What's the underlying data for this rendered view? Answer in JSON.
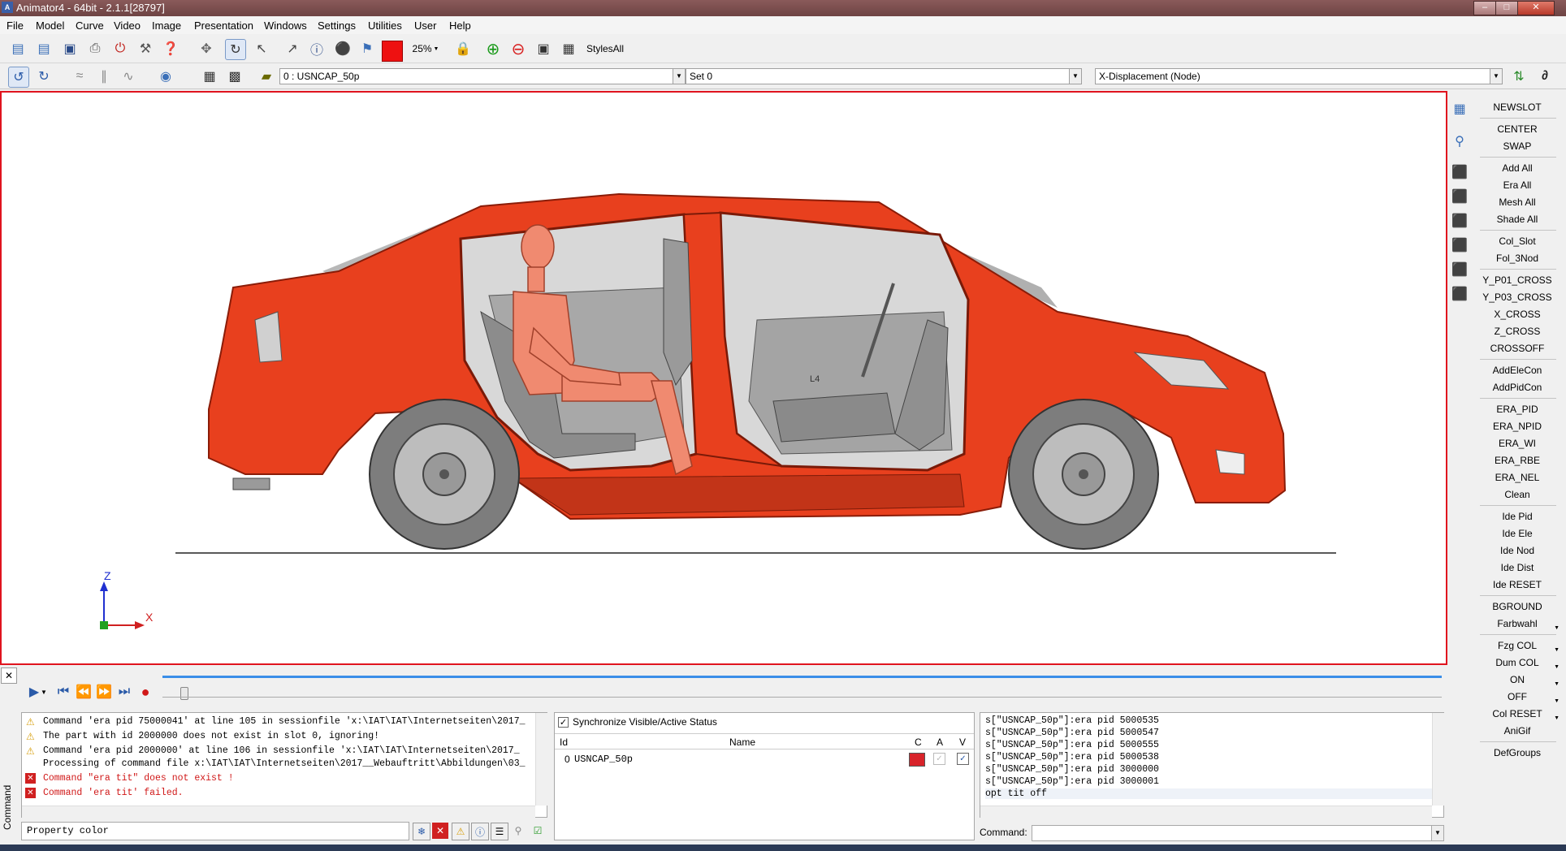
{
  "window": {
    "title": "Animator4 - 64bit - 2.1.1[28797]",
    "app_icon_text": "A"
  },
  "menu": [
    "File",
    "Model",
    "Curve",
    "Video",
    "Image",
    "Presentation",
    "Windows",
    "Settings",
    "Utilities",
    "User",
    "Help"
  ],
  "toolbar1": {
    "zoom_label": "25%",
    "styles_label": "StylesAll"
  },
  "toolbar2": {
    "model_combo": "0 : USNCAP_50p",
    "set_combo": "Set 0",
    "result_combo": "X-Displacement (Node)"
  },
  "viewport": {
    "axis_z": "Z",
    "axis_x": "X",
    "dummy_label": "L4"
  },
  "right_panel": [
    {
      "label": "NEWSLOT"
    },
    {
      "label": "CENTER"
    },
    {
      "label": "SWAP"
    },
    {
      "label": "Add All"
    },
    {
      "label": "Era All"
    },
    {
      "label": "Mesh All"
    },
    {
      "label": "Shade All"
    },
    {
      "label": "Col_Slot"
    },
    {
      "label": "Fol_3Nod"
    },
    {
      "label": "Y_P01_CROSS"
    },
    {
      "label": "Y_P03_CROSS"
    },
    {
      "label": "X_CROSS"
    },
    {
      "label": "Z_CROSS"
    },
    {
      "label": "CROSSOFF"
    },
    {
      "label": "AddEleCon"
    },
    {
      "label": "AddPidCon"
    },
    {
      "label": "ERA_PID"
    },
    {
      "label": "ERA_NPID"
    },
    {
      "label": "ERA_WI"
    },
    {
      "label": "ERA_RBE"
    },
    {
      "label": "ERA_NEL"
    },
    {
      "label": "Clean"
    },
    {
      "label": "Ide Pid"
    },
    {
      "label": "Ide Ele"
    },
    {
      "label": "Ide Nod"
    },
    {
      "label": "Ide Dist"
    },
    {
      "label": "Ide RESET"
    },
    {
      "label": "BGROUND"
    },
    {
      "label": "Farbwahl"
    },
    {
      "label": "Fzg COL"
    },
    {
      "label": "Dum COL"
    },
    {
      "label": "ON"
    },
    {
      "label": "OFF"
    },
    {
      "label": "Col RESET"
    },
    {
      "label": "AniGif"
    },
    {
      "label": "DefGroups"
    }
  ],
  "log": {
    "vertical_tab": "Command",
    "lines": [
      {
        "type": "warn",
        "text": "Command 'era pid 75000041' at line 105 in sessionfile 'x:\\IAT\\IAT\\Internetseiten\\2017_"
      },
      {
        "type": "warn",
        "text": "The part with id 2000000 does not exist in slot 0, ignoring!"
      },
      {
        "type": "warn",
        "text": "Command 'era pid 2000000' at line 106 in sessionfile 'x:\\IAT\\IAT\\Internetseiten\\2017_"
      },
      {
        "type": "info",
        "text": "Processing of command file x:\\IAT\\IAT\\Internetseiten\\2017__Webauftritt\\Abbildungen\\03_"
      },
      {
        "type": "error",
        "text": "Command \"era tit\" does not exist !"
      },
      {
        "type": "error",
        "text": "Command 'era tit' failed."
      }
    ],
    "property_label": "Property color"
  },
  "properties": {
    "sync_label": "Synchronize Visible/Active Status",
    "col_id": "Id",
    "col_name": "Name",
    "col_c": "C",
    "col_a": "A",
    "col_v": "V",
    "rows": [
      {
        "id": "0",
        "name": "USNCAP_50p"
      }
    ],
    "row_color": "#d8232a"
  },
  "cmd_history": {
    "lines": [
      "s[\"USNCAP_50p\"]:era pid 5000535",
      "s[\"USNCAP_50p\"]:era pid 5000547",
      "s[\"USNCAP_50p\"]:era pid 5000555",
      "s[\"USNCAP_50p\"]:era pid 5000538",
      "s[\"USNCAP_50p\"]:era pid 3000000",
      "s[\"USNCAP_50p\"]:era pid 3000001",
      "opt tit off"
    ],
    "command_label": "Command:"
  },
  "colors": {
    "body": "#e8401e",
    "body_dark": "#b82c10",
    "interior": "#9a9a9a",
    "frame_red": "#e0141e"
  }
}
